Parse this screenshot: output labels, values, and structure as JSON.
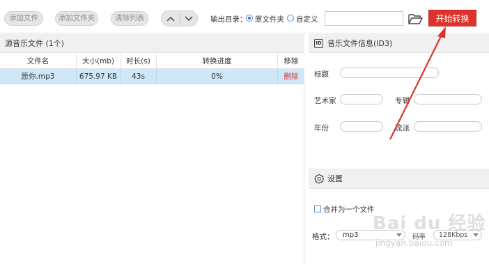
{
  "toolbar": {
    "add_file": "添加文件",
    "add_folder": "添加文件夹",
    "clear_list": "清除列表",
    "output_dir_label": "输出目录：",
    "radio_original": "原文件夹",
    "radio_custom": "自定义",
    "output_path_value": "",
    "start_button": "开始转换"
  },
  "left_panel": {
    "title": "源音乐文件 (1个)",
    "columns": [
      "文件名",
      "大小(mb)",
      "时长(s)",
      "转换进度",
      "移除"
    ],
    "rows": [
      {
        "name": "愿你.mp3",
        "size": "675.97 KB",
        "duration": "43s",
        "progress": "0%",
        "remove": "删除"
      }
    ]
  },
  "right_panel": {
    "id3_title": "音乐文件信息(ID3)",
    "id3_icon_text": "ID",
    "fields": {
      "title_label": "标题",
      "artist_label": "艺术家",
      "album_label": "专辑",
      "year_label": "年份",
      "genre_label": "流派"
    },
    "settings_title": "设置",
    "merge_label": "合并为一个文件",
    "format_label": "格式：",
    "format_value": "mp3",
    "bitrate_label": "码率",
    "bitrate_value": "128Kbps"
  },
  "watermark": {
    "brand": "Bai du 经验",
    "url": "jingyan.baidu.com"
  },
  "colors": {
    "accent_red": "#e0322d",
    "selected_row": "#cfe8f8",
    "panel_header": "#f0f0f0"
  }
}
